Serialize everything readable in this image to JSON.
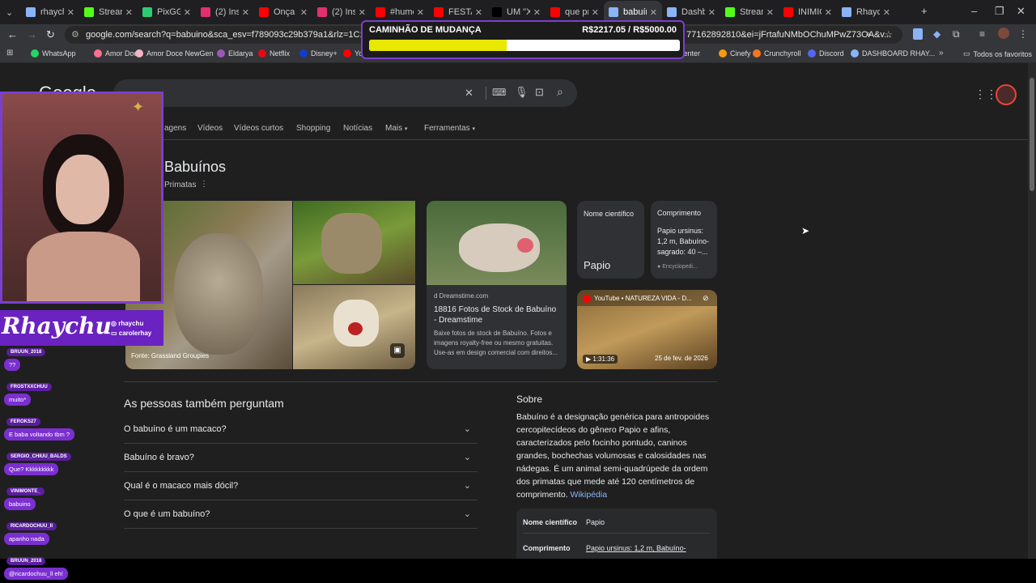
{
  "browser": {
    "tabs": [
      {
        "label": "rhaych",
        "color": "#8ab4f8",
        "active": false
      },
      {
        "label": "Stream",
        "color": "#53fc18",
        "active": false
      },
      {
        "label": "PixGG",
        "color": "#2ecc71",
        "active": false
      },
      {
        "label": "(2) Insta",
        "color": "#e1306c",
        "active": false
      },
      {
        "label": "Onça p",
        "color": "#ff0000",
        "active": false
      },
      {
        "label": "(2) Insta",
        "color": "#e1306c",
        "active": false
      },
      {
        "label": "#humo",
        "color": "#ff0000",
        "active": false
      },
      {
        "label": "FESTA",
        "color": "#ff0000",
        "active": false
      },
      {
        "label": "UM \"X",
        "color": "#000000",
        "active": false
      },
      {
        "label": "que pr",
        "color": "#ff0000",
        "active": false
      },
      {
        "label": "babuín",
        "color": "#8ab4f8",
        "active": true
      },
      {
        "label": "Dashb",
        "color": "#8ab4f8",
        "active": false
      },
      {
        "label": "Stream",
        "color": "#53fc18",
        "active": false
      },
      {
        "label": "INIMIG",
        "color": "#ff0000",
        "active": false
      },
      {
        "label": "Rhaych",
        "color": "#8ab4f8",
        "active": false
      }
    ],
    "url": "google.com/search?q=babuino&sca_esv=f789093c29b379a1&rlz=1C1VDKB_pt-PT",
    "url_tail": "77162892810&ei=jFrtafuNMbOChuMPwZ73OA&v...",
    "bookmarks": [
      {
        "label": "WhatsApp",
        "color": "#25d366"
      },
      {
        "label": "Amor Doce",
        "color": "#ff6f91"
      },
      {
        "label": "Amor Doce NewGen",
        "color": "#f4b4c4"
      },
      {
        "label": "Eldarya",
        "color": "#9b59b6"
      },
      {
        "label": "Netflix",
        "color": "#e50914"
      },
      {
        "label": "Disney+",
        "color": "#113ccf"
      },
      {
        "label": "Yo",
        "color": "#ff0000"
      },
      {
        "label": "Center",
        "color": ""
      },
      {
        "label": "Cinefy",
        "color": "#f39c12"
      },
      {
        "label": "Crunchyroll",
        "color": "#f47521"
      },
      {
        "label": "Discord",
        "color": "#5865f2"
      },
      {
        "label": "DASHBOARD RHAY...",
        "color": "#8ab4f8"
      }
    ],
    "favorites_label": "Todos os favoritos"
  },
  "goal": {
    "title": "CAMINHÃO DE MUDANÇA",
    "amount": "R$2217.05 / R$5000.00",
    "progress": 0.443
  },
  "google": {
    "logo": "Google",
    "nav_tabs": [
      "agens",
      "Vídeos",
      "Vídeos curtos",
      "Shopping",
      "Notícias",
      "Mais",
      "Ferramentas"
    ],
    "entity_title": "Babuínos",
    "entity_subtitle": "Primatas",
    "image_credit": "Fonte: Grassland Groupies",
    "result": {
      "source": "Dreamstime.com",
      "title": "18816 Fotos de Stock de Babuíno - Dreamstime",
      "snippet": "Baixe fotos de stock de Babuíno. Fotos e imagens royalty-free ou mesmo gratuitas. Use-as em design comercial com direitos..."
    },
    "info_cards": {
      "sci_label": "Nome científico",
      "sci_value": "Papio",
      "len_label": "Comprimento",
      "len_value": "Papio ursinus: 1,2 m, Babuíno-sagrado: 40 –...",
      "len_source": "Encyclopedi..."
    },
    "video": {
      "channel": "YouTube • NATUREZA VIDA - D...",
      "duration": "1:31:36",
      "date": "25 de fev. de 2026"
    },
    "paa_title": "As pessoas também perguntam",
    "paa": [
      "O babuíno é um macaco?",
      "Babuíno é bravo?",
      "Qual é o macaco mais dócil?",
      "O que é um babuíno?"
    ],
    "about_title": "Sobre",
    "about_text": "Babuíno é a designação genérica para antropoides cercopitecídeos do gênero Papio e afins, caracterizados pelo focinho pontudo, caninos grandes, bochechas volumosas e calosidades nas nádegas. É um animal semi-quadrúpede da ordem dos primatas que mede até 120 centímetros de comprimento.",
    "about_link": "Wikipédia",
    "facts": [
      {
        "label": "Nome científico",
        "value": "Papio"
      },
      {
        "label": "Comprimento",
        "value": "Papio ursinus: 1,2 m, Babuíno-"
      }
    ]
  },
  "stream": {
    "brand": "Rhaychu",
    "socials": [
      "rhaychu",
      "carolerhay"
    ],
    "chat": [
      {
        "user": "BRUUN_2018",
        "msg": "??"
      },
      {
        "user": "FROSTXXCHUU",
        "msg": "muito*"
      },
      {
        "user": "FEROKS27",
        "msg": "E baba voltando tbm ?"
      },
      {
        "user": "SERGIO_CHIUU_BALDS",
        "msg": "Que? Kkkkkkkkk"
      },
      {
        "user": "VINIMONTE_",
        "msg": "babuino"
      },
      {
        "user": "RICARDOCHUU_II",
        "msg": "apanho nada"
      },
      {
        "user": "BRUUN_2018",
        "msg": "@ricardochuu_ll eh!"
      }
    ]
  }
}
